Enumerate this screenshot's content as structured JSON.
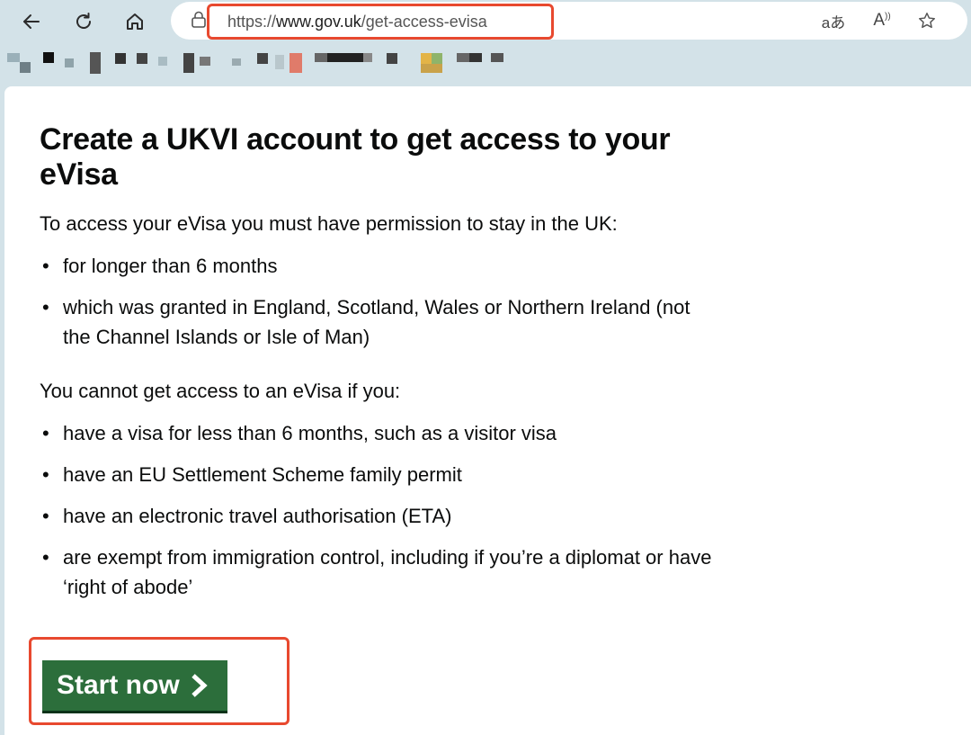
{
  "browser": {
    "url_scheme": "https://",
    "url_host": "www.gov.uk",
    "url_path": "/get-access-evisa",
    "translate_icon_text": "aあ",
    "read_aloud_icon_text": "A",
    "icons": [
      "back-arrow-icon",
      "reload-icon",
      "home-icon",
      "lock-icon",
      "translate-icon",
      "read-aloud-icon",
      "favorite-star-icon"
    ],
    "highlight_color": "#e8492f"
  },
  "page": {
    "title": "Create a UKVI account to get access to your eVisa",
    "intro": "To access your eVisa you must have permission to stay in the UK:",
    "permission_conditions": [
      "for longer than 6 months",
      "which was granted in England, Scotland, Wales or Northern Ireland (not the Channel Islands or Isle of Man)"
    ],
    "cannot_intro": "You cannot get access to an eVisa if you:",
    "exclusions": [
      "have a visa for less than 6 months, such as a visitor visa",
      "have an EU Settlement Scheme family permit",
      "have an electronic travel authorisation (ETA)",
      "are exempt from immigration control, including if you’re a diplomat or have ‘right of abode’"
    ],
    "start_button_label": "Start now",
    "start_button_color": "#2c6e3b"
  }
}
